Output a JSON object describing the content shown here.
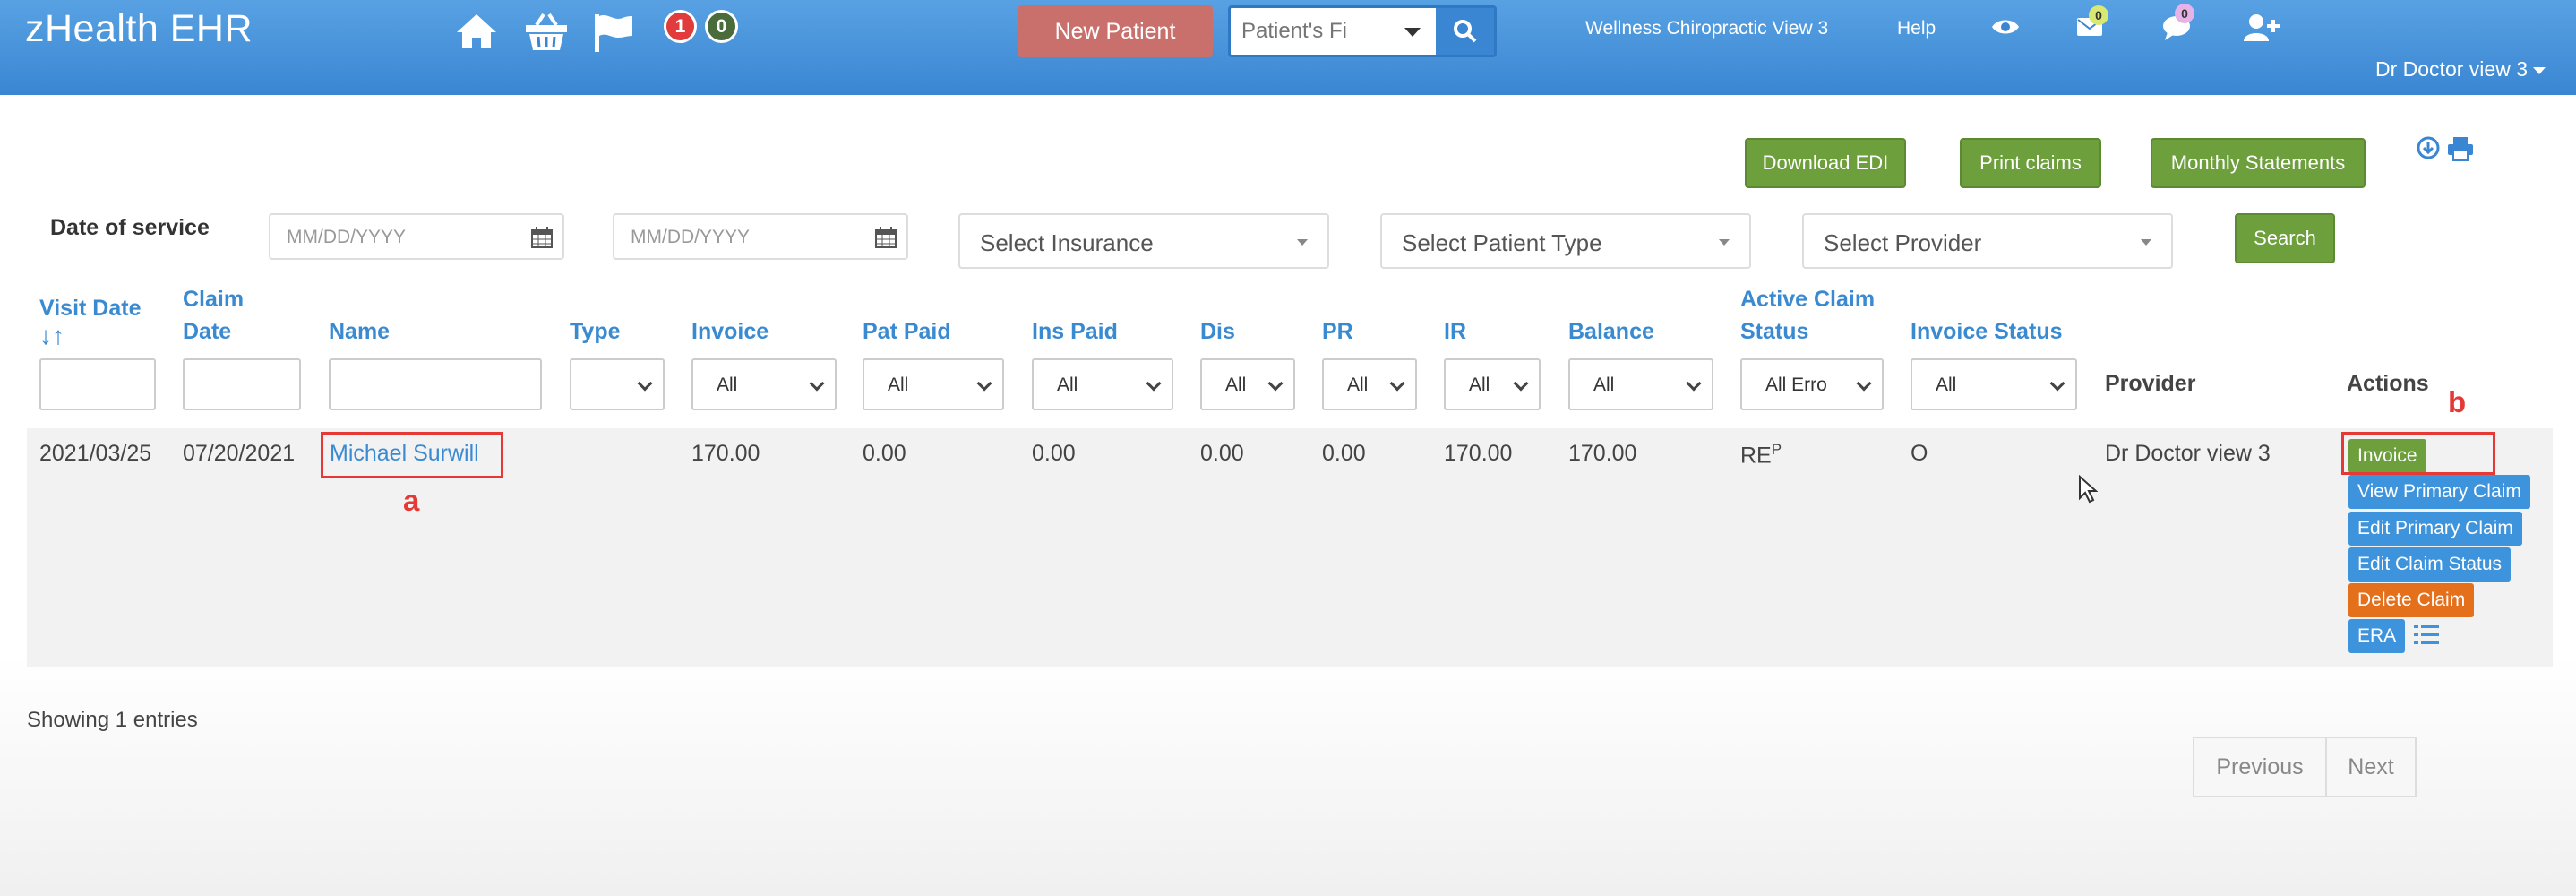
{
  "navbar": {
    "brand": "zHealth EHR",
    "icons": [
      "home-icon",
      "basket-icon",
      "flag-icon"
    ],
    "badge_red_count": "1",
    "badge_green_count": "0",
    "new_patient_label": "New Patient",
    "patient_search_placeholder": "Patient's Fi",
    "clinic_link": "Wellness Chiropractic View 3",
    "help_link": "Help",
    "messages_count": "0",
    "chat_count": "0",
    "user_name": "Dr Doctor view 3",
    "colors": {
      "navbar": "#3a86d2",
      "new_patient": "#c9706d"
    }
  },
  "toolbar": {
    "download_edi": "Download EDI",
    "print_claims": "Print claims",
    "monthly_statements": "Monthly Statements"
  },
  "filters": {
    "date_of_service_label": "Date of service",
    "date_from_placeholder": "MM/DD/YYYY",
    "date_to_placeholder": "MM/DD/YYYY",
    "insurance": "Select Insurance",
    "patient_type": "Select Patient Type",
    "provider": "Select Provider",
    "search_label": "Search"
  },
  "table": {
    "headers": {
      "visit_date": "Visit Date",
      "sort_icon": "↓↑",
      "claim_date_1": "Claim",
      "claim_date_2": "Date",
      "name": "Name",
      "type": "Type",
      "invoice": "Invoice",
      "pat_paid": "Pat Paid",
      "ins_paid": "Ins Paid",
      "dis": "Dis",
      "pr": "PR",
      "ir": "IR",
      "balance": "Balance",
      "active_claim_1": "Active Claim",
      "active_claim_2": "Status",
      "invoice_status": "Invoice Status",
      "provider": "Provider",
      "actions": "Actions"
    },
    "filter_values": {
      "type": "",
      "invoice": "All",
      "pat_paid": "All",
      "ins_paid": "All",
      "dis": "All",
      "pr": "All",
      "ir": "All",
      "balance": "All",
      "active_claim": "All Erro",
      "invoice_status": "All"
    },
    "row": {
      "visit_date": "2021/03/25",
      "claim_date": "07/20/2021",
      "name": "Michael Surwill",
      "invoice": "170.00",
      "pat_paid": "0.00",
      "ins_paid": "0.00",
      "dis": "0.00",
      "pr": "0.00",
      "ir": "170.00",
      "balance": "170.00",
      "claim_status": "RE",
      "claim_status_sup": "P",
      "invoice_status": "O",
      "provider": "Dr Doctor view 3"
    },
    "actions": {
      "invoice": "Invoice",
      "view_primary": "View Primary Claim",
      "edit_primary": "Edit Primary Claim",
      "edit_status": "Edit Claim Status",
      "delete": "Delete Claim",
      "era": "ERA"
    }
  },
  "annotations": {
    "a": "a",
    "b": "b"
  },
  "footer": {
    "showing": "Showing 1 entries",
    "previous": "Previous",
    "next": "Next"
  }
}
